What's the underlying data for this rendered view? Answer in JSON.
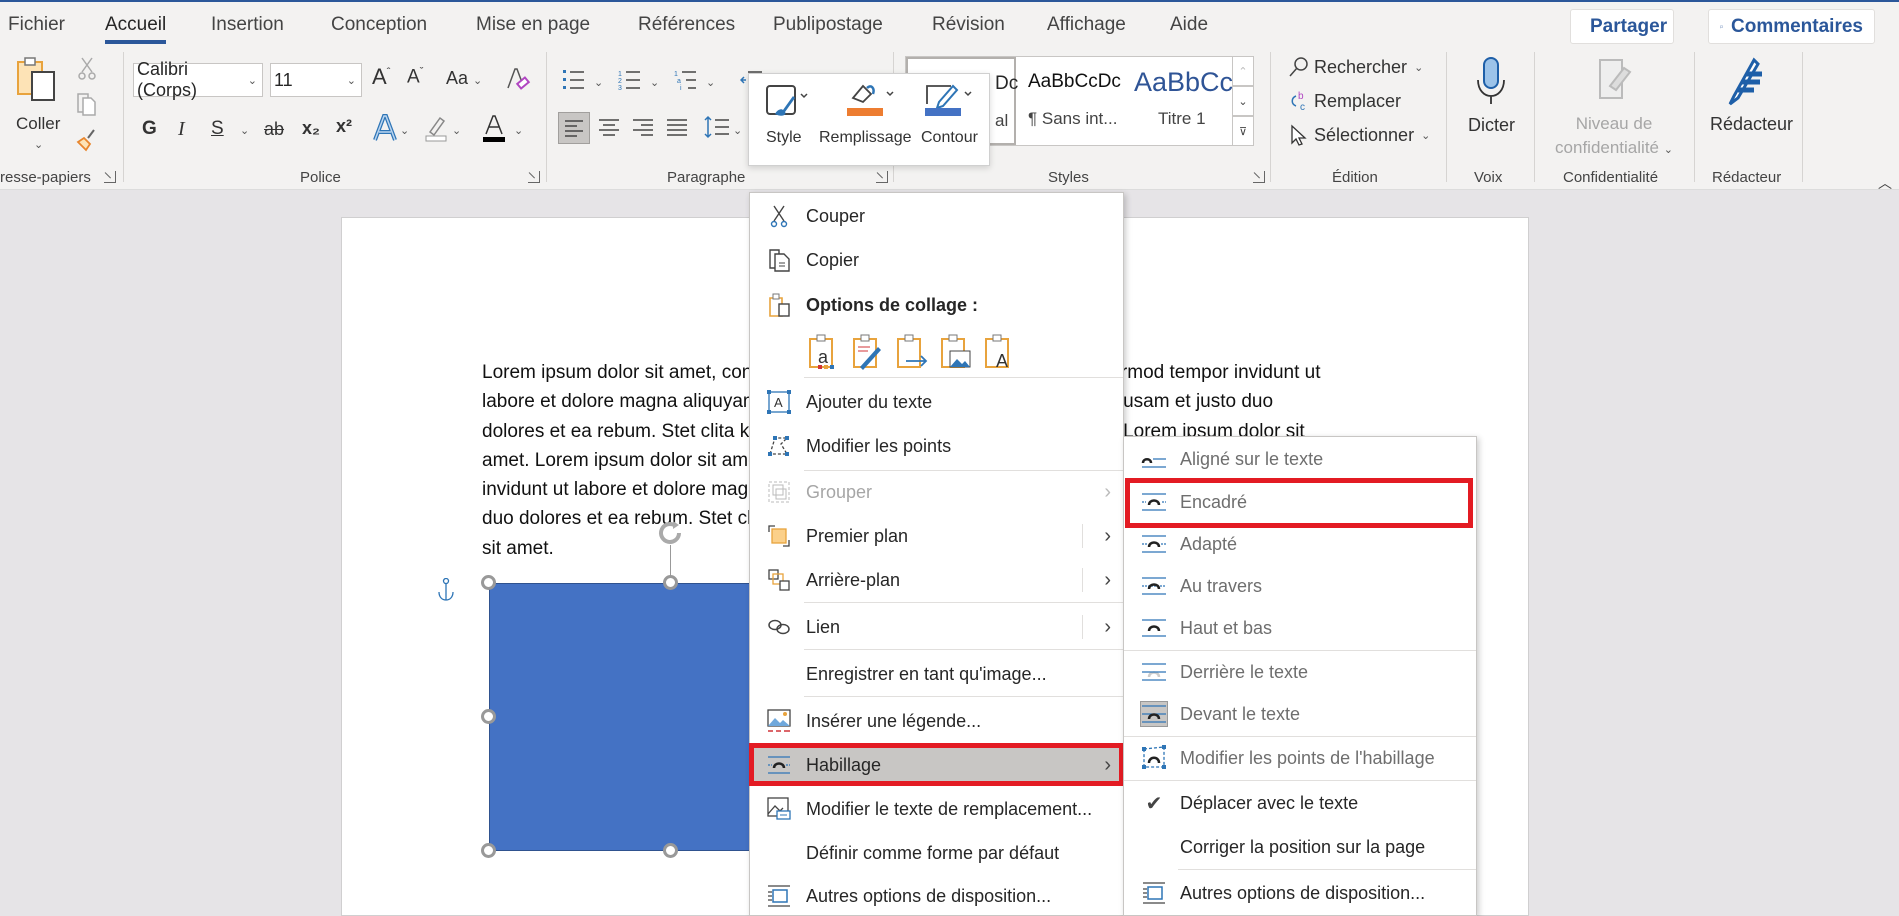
{
  "tabs": [
    {
      "label": "Fichier",
      "active": false
    },
    {
      "label": "Accueil",
      "active": true
    },
    {
      "label": "Insertion",
      "active": false
    },
    {
      "label": "Conception",
      "active": false
    },
    {
      "label": "Mise en page",
      "active": false
    },
    {
      "label": "Références",
      "active": false
    },
    {
      "label": "Publipostage",
      "active": false
    },
    {
      "label": "Révision",
      "active": false
    },
    {
      "label": "Affichage",
      "active": false
    },
    {
      "label": "Aide",
      "active": false
    }
  ],
  "top_buttons": {
    "share": "Partager",
    "comments": "Commentaires"
  },
  "ribbon": {
    "clipboard": {
      "paste": "Coller",
      "group_label": "resse-papiers"
    },
    "font": {
      "name": "Calibri (Corps)",
      "size": "11",
      "bold": "G",
      "italic": "I",
      "underline": "S",
      "strike": "ab",
      "subscript": "x₂",
      "superscript": "x²",
      "grow": "A",
      "shrink": "A",
      "case": "Aa",
      "group_label": "Police",
      "font_color": "#000000",
      "highlight_color": "#ffffff"
    },
    "paragraph": {
      "group_label": "Paragraphe"
    },
    "styles": {
      "items": [
        {
          "sample": "AaBbCcDc",
          "name": "¶ Normal"
        },
        {
          "sample": "AaBbCcDc",
          "name": "¶ Sans int..."
        },
        {
          "sample": "AaBbCc",
          "name": "Titre 1"
        }
      ],
      "visible_first_sample": "Dc",
      "visible_first_name": "al",
      "group_label": "Styles"
    },
    "editing": {
      "find": "Rechercher",
      "replace": "Remplacer",
      "select": "Sélectionner",
      "group_label": "Édition"
    },
    "voice": {
      "dictate": "Dicter",
      "group_label": "Voix"
    },
    "sensitivity": {
      "label_line1": "Niveau de",
      "label_line2": "confidentialité",
      "group_label": "Confidentialité"
    },
    "editor": {
      "label": "Rédacteur",
      "group_label": "Rédacteur"
    }
  },
  "mini_toolbar": {
    "style": "Style",
    "fill": "Remplissage",
    "outline": "Contour",
    "fill_color": "#ed7d31",
    "outline_color": "#4472c4"
  },
  "document": {
    "lines": [
      "Lorem ipsum dolor sit amet, consetetur sadipscing elitr, sed diam nonumy eirmod tempor invidunt ut",
      "labore et dolore magna aliquyam erat, sed diam voluptua. At vero eos et accusam et justo duo",
      "dolores et ea rebum. Stet clita kasd gubergren, no sea takimata sanctus est Lorem ipsum dolor sit",
      "amet. Lorem ipsum dolor sit amet, consetetur sadipscing elitr, sed diam nonumy eirmod tempor",
      "invidunt ut labore et dolore magna aliquyam erat, sed diam voluptua. At vero eos et accusam et justo",
      "duo dolores et ea rebum. Stet clita kasd gubergren, no sea takimata sanctus est Lorem ipsum dolor",
      "sit amet."
    ],
    "shape_color": "#4472c4"
  },
  "context_menu": {
    "cut": "Couper",
    "copy": "Copier",
    "paste_options": "Options de collage :",
    "add_text": "Ajouter du texte",
    "edit_points": "Modifier les points",
    "group": "Grouper",
    "bring_forward": "Premier plan",
    "send_backward": "Arrière-plan",
    "link": "Lien",
    "save_as_picture": "Enregistrer en tant qu'image...",
    "insert_caption": "Insérer une légende...",
    "wrap_text": "Habillage",
    "edit_alt_text": "Modifier le texte de remplacement...",
    "set_default": "Définir comme forme par défaut",
    "more_layout": "Autres options de disposition..."
  },
  "wrap_submenu": {
    "in_line": "Aligné sur le texte",
    "square": "Encadré",
    "tight": "Adapté",
    "through": "Au travers",
    "top_bottom": "Haut et bas",
    "behind": "Derrière le texte",
    "in_front": "Devant le texte",
    "edit_wrap_points": "Modifier les points de l'habillage",
    "move_with_text": "Déplacer avec le texte",
    "move_with_text_checked": true,
    "fix_position": "Corriger la position sur la page",
    "more_layout": "Autres options de disposition..."
  },
  "colors": {
    "accent": "#2b579a",
    "highlight_box": "#e31b23"
  }
}
